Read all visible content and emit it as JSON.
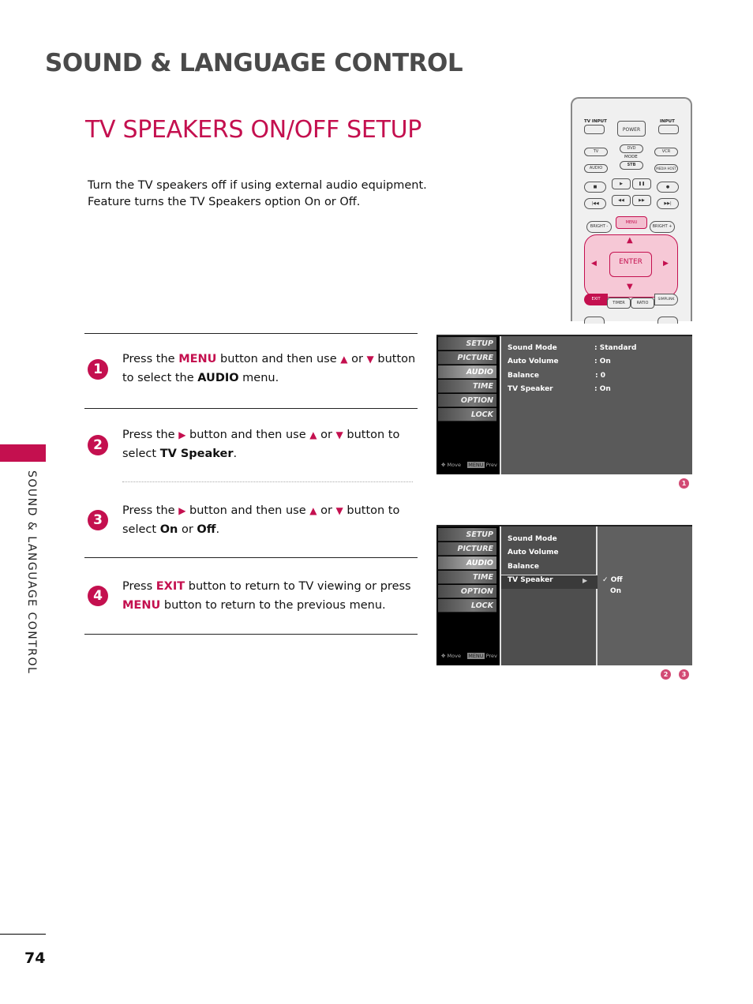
{
  "header": {
    "section_title": "SOUND & LANGUAGE CONTROL",
    "page_title": "TV SPEAKERS ON/OFF SETUP"
  },
  "intro": {
    "line1": "Turn the TV speakers off if using external audio equipment.",
    "line2": "Feature turns the TV Speakers option On or Off."
  },
  "side_tab": {
    "label": "SOUND & LANGUAGE CONTROL",
    "accent_color": "#c4104f"
  },
  "page_number": "74",
  "steps": [
    {
      "num": "1",
      "parts": [
        "Press the ",
        "MENU",
        " button and then use ",
        "▲",
        " or ",
        "▼",
        " button",
        "to select the ",
        "AUDIO",
        " menu."
      ]
    },
    {
      "num": "2",
      "parts": [
        "Press the ",
        "▶",
        " button and then use ",
        "▲",
        " or ",
        "▼",
        " button to",
        "select ",
        "TV Speaker",
        "."
      ]
    },
    {
      "num": "3",
      "parts": [
        "Press the ",
        "▶",
        " button and then use ",
        "▲",
        " or ",
        "▼",
        " button to",
        "select ",
        "On",
        " or ",
        "Off",
        "."
      ]
    },
    {
      "num": "4",
      "parts": [
        "Press ",
        "EXIT",
        " button to return to TV viewing or press",
        "MENU",
        " button to return to the previous menu."
      ]
    }
  ],
  "tv_menu": {
    "items": [
      "SETUP",
      "PICTURE",
      "AUDIO",
      "TIME",
      "OPTION",
      "LOCK"
    ],
    "footer_move": "Move",
    "footer_menu": "MENU",
    "footer_prev": "Prev"
  },
  "screen1": {
    "rows": [
      {
        "label": "Sound Mode",
        "value": ": Standard"
      },
      {
        "label": "Auto Volume",
        "value": ": On"
      },
      {
        "label": "Balance",
        "value": ": 0"
      },
      {
        "label": "TV Speaker",
        "value": ": On"
      }
    ],
    "badge": "1"
  },
  "screen2": {
    "rows": [
      "Sound Mode",
      "Auto Volume",
      "Balance",
      "TV Speaker"
    ],
    "submenu_arrow": "▶",
    "options": [
      {
        "label": "Off",
        "checked": true,
        "check": "✓"
      },
      {
        "label": "On",
        "checked": false
      }
    ],
    "badges": [
      "2",
      "3"
    ]
  },
  "remote": {
    "tv_input": "TV INPUT",
    "power": "POWER",
    "input": "INPUT",
    "tv": "TV",
    "dvd": "DVD",
    "vcr": "VCR",
    "mode": "MODE",
    "audio": "AUDIO",
    "stb": "STB",
    "media_host": "MEDIA HOST",
    "stop": "■",
    "play": "▶",
    "pause": "❚❚",
    "rec": "●",
    "skip_back": "|◀◀",
    "rew": "◀◀",
    "ff": "▶▶",
    "skip_fwd": "▶▶|",
    "bright_minus": "BRIGHT -",
    "menu": "MENU",
    "bright_plus": "BRIGHT +",
    "enter": "ENTER",
    "up": "▲",
    "down": "▼",
    "left": "◀",
    "right": "▶",
    "exit": "EXIT",
    "timer": "TIMER",
    "ratio": "RATIO",
    "simplink": "SIMPLINK"
  }
}
